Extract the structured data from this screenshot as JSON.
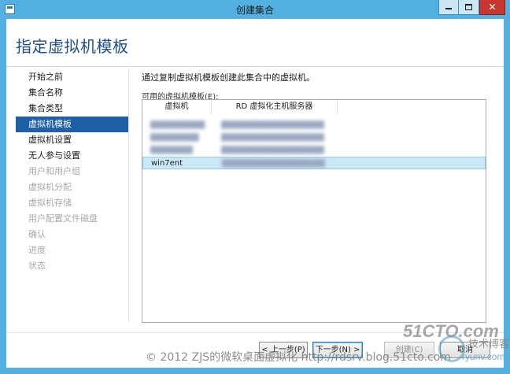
{
  "window": {
    "title": "创建集合",
    "controls": {
      "minimize": "—",
      "maximize": "□",
      "close": "✕"
    }
  },
  "page": {
    "title": "指定虚拟机模板",
    "description": "通过复制虚拟机模板创建此集合中的虚拟机。",
    "list_label": "可用的虚拟机模板(E):"
  },
  "nav": {
    "items": [
      {
        "label": "开始之前",
        "state": "normal"
      },
      {
        "label": "集合名称",
        "state": "normal"
      },
      {
        "label": "集合类型",
        "state": "normal"
      },
      {
        "label": "虚拟机模板",
        "state": "active"
      },
      {
        "label": "虚拟机设置",
        "state": "normal"
      },
      {
        "label": "无人参与设置",
        "state": "normal"
      },
      {
        "label": "用户和用户组",
        "state": "disabled"
      },
      {
        "label": "虚拟机分配",
        "state": "disabled"
      },
      {
        "label": "虚拟机存储",
        "state": "disabled"
      },
      {
        "label": "用户配置文件磁盘",
        "state": "disabled"
      },
      {
        "label": "确认",
        "state": "disabled"
      },
      {
        "label": "进度",
        "state": "disabled"
      },
      {
        "label": "状态",
        "state": "disabled"
      }
    ]
  },
  "table": {
    "columns": [
      "虚拟机",
      "RD 虚拟化主机服务器"
    ],
    "rows": [
      {
        "vm": "",
        "host": "",
        "blurred": true,
        "selected": false
      },
      {
        "vm": "",
        "host": "",
        "blurred": true,
        "selected": false
      },
      {
        "vm": "",
        "host": "",
        "blurred": true,
        "selected": false
      },
      {
        "vm": "win7ent",
        "host": "",
        "blurred": true,
        "selected": true
      }
    ]
  },
  "buttons": {
    "prev": "< 上一步(P)",
    "next": "下一步(N) >",
    "create": "创建(C)",
    "cancel": "取消"
  },
  "watermark": {
    "copyright": "© 2012 ZJS的微软桌面虚拟化 http://rdsrv.blog.51cto.com",
    "logo1": "51CTO.com",
    "logo2_text": "技术博客",
    "logo2_url": "ryunv.com"
  },
  "colors": {
    "accent": "#1f5fa8",
    "title_blue": "#1f4e8c",
    "frame": "#52b1e0",
    "selection": "#cbe8f6"
  }
}
